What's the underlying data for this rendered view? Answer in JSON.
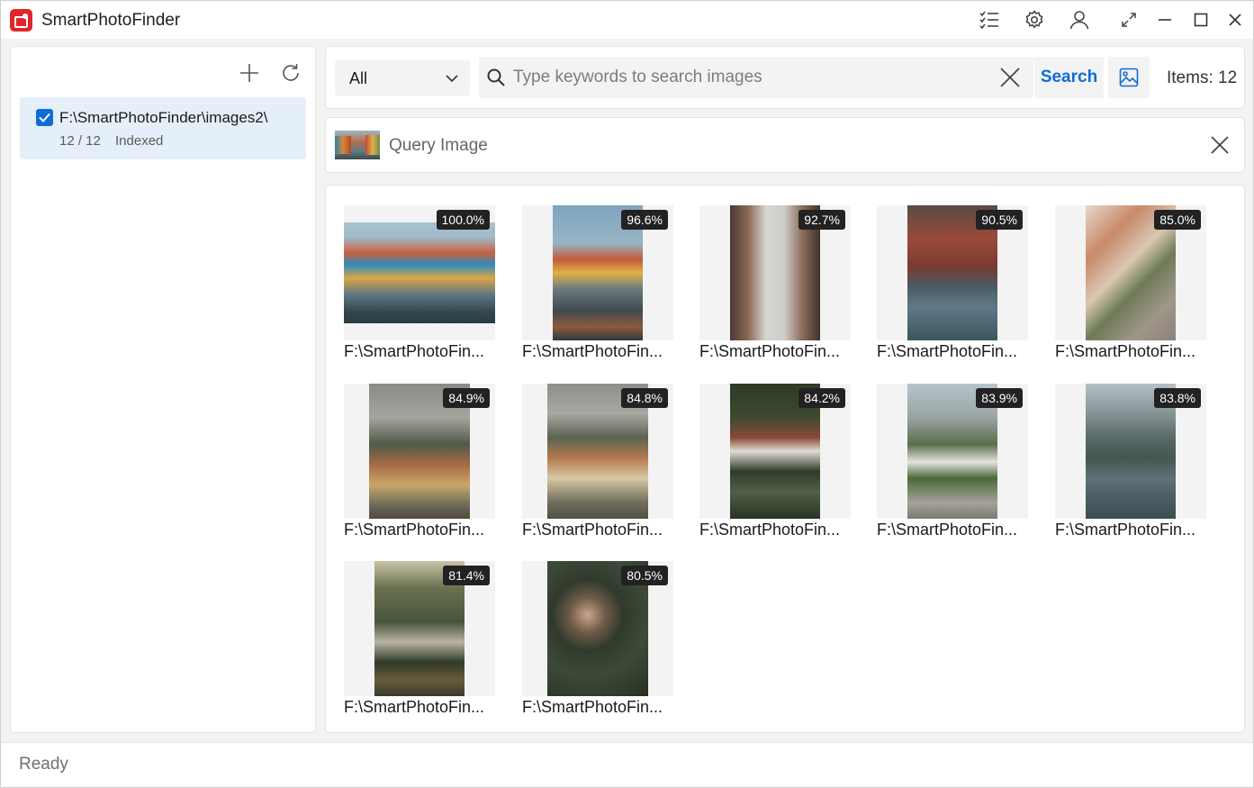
{
  "app": {
    "title": "SmartPhotoFinder"
  },
  "titlebar": {
    "icons": [
      "tasks-icon",
      "gear-icon",
      "user-icon",
      "fullscreen-icon",
      "minimize-icon",
      "maximize-icon",
      "close-icon"
    ]
  },
  "sidebar": {
    "folders": [
      {
        "path": "F:\\SmartPhotoFinder\\images2\\",
        "count": "12 / 12",
        "status": "Indexed",
        "checked": true
      }
    ]
  },
  "toolbar": {
    "filter_value": "All",
    "search_placeholder": "Type keywords to search images",
    "search_value": "",
    "search_label": "Search",
    "items_count": "Items: 12"
  },
  "query": {
    "label": "Query Image"
  },
  "results": [
    {
      "score": "100.0%",
      "label": "F:\\SmartPhotoFin..."
    },
    {
      "score": "96.6%",
      "label": "F:\\SmartPhotoFin..."
    },
    {
      "score": "92.7%",
      "label": "F:\\SmartPhotoFin..."
    },
    {
      "score": "90.5%",
      "label": "F:\\SmartPhotoFin..."
    },
    {
      "score": "85.0%",
      "label": "F:\\SmartPhotoFin..."
    },
    {
      "score": "84.9%",
      "label": "F:\\SmartPhotoFin..."
    },
    {
      "score": "84.8%",
      "label": "F:\\SmartPhotoFin..."
    },
    {
      "score": "84.2%",
      "label": "F:\\SmartPhotoFin..."
    },
    {
      "score": "83.9%",
      "label": "F:\\SmartPhotoFin..."
    },
    {
      "score": "83.8%",
      "label": "F:\\SmartPhotoFin..."
    },
    {
      "score": "81.4%",
      "label": "F:\\SmartPhotoFin..."
    },
    {
      "score": "80.5%",
      "label": "F:\\SmartPhotoFin..."
    }
  ],
  "status": {
    "text": "Ready"
  },
  "colors": {
    "accent": "#0f6cd6",
    "brand": "#e0262a",
    "selection": "#e5eff9",
    "badge": "#222222"
  }
}
